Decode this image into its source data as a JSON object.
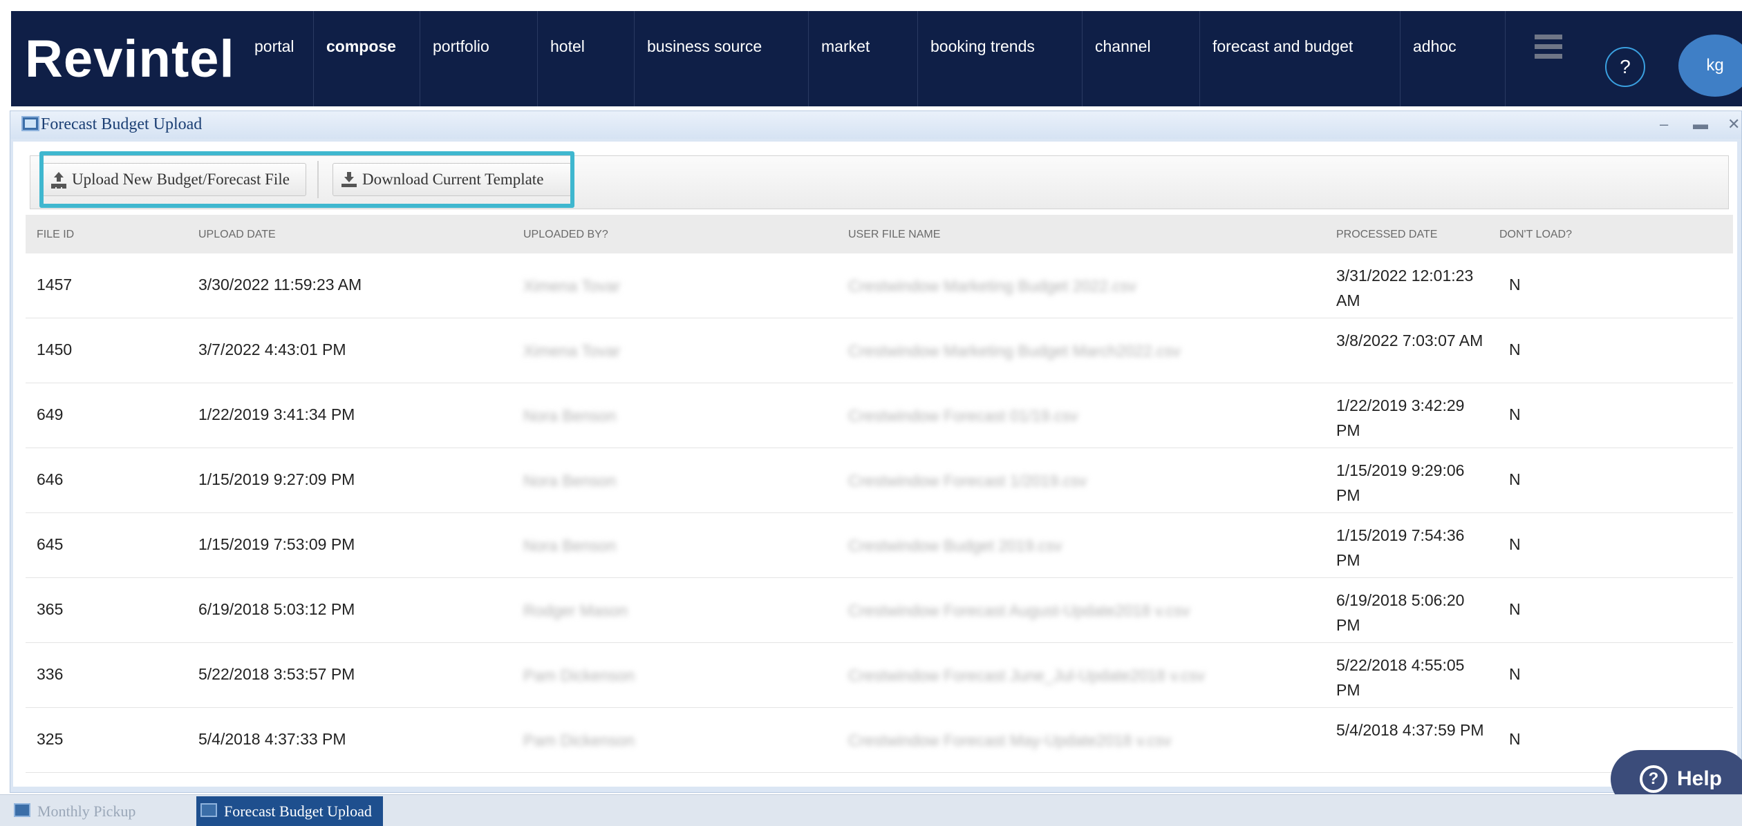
{
  "app": {
    "logo": "Revintel"
  },
  "nav": {
    "items": [
      {
        "label": "portal"
      },
      {
        "label": "compose"
      },
      {
        "label": "portfolio"
      },
      {
        "label": "hotel"
      },
      {
        "label": "business source"
      },
      {
        "label": "market"
      },
      {
        "label": "booking trends"
      },
      {
        "label": "channel"
      },
      {
        "label": "forecast and budget"
      },
      {
        "label": "adhoc"
      }
    ],
    "active": "compose",
    "help_glyph": "?",
    "avatar_initials": "kg"
  },
  "window": {
    "title": "Forecast Budget Upload",
    "controls": {
      "minimize": "–",
      "maximize": "▬",
      "close": "✕"
    }
  },
  "toolbar": {
    "upload_label": "Upload New Budget/Forecast File",
    "download_label": "Download Current Template"
  },
  "table": {
    "headers": {
      "file_id": "FILE ID",
      "upload_date": "UPLOAD DATE",
      "uploaded_by": "UPLOADED BY?",
      "user_file_name": "USER FILE NAME",
      "processed_date": "PROCESSED DATE",
      "dont_load": "DON'T LOAD?"
    },
    "rows": [
      {
        "file_id": "1457",
        "upload_date": "3/30/2022 11:59:23 AM",
        "uploaded_by": "Ximena Tovar",
        "user_file_name": "Crestwindow Marketing Budget 2022.csv",
        "processed_date": "3/31/2022 12:01:23 AM",
        "dont_load": "N"
      },
      {
        "file_id": "1450",
        "upload_date": "3/7/2022 4:43:01 PM",
        "uploaded_by": "Ximena Tovar",
        "user_file_name": "Crestwindow Marketing Budget March2022.csv",
        "processed_date": "3/8/2022 7:03:07 AM",
        "dont_load": "N"
      },
      {
        "file_id": "649",
        "upload_date": "1/22/2019 3:41:34 PM",
        "uploaded_by": "Nora Benson",
        "user_file_name": "Crestwindow Forecast 01/19.csv",
        "processed_date": "1/22/2019 3:42:29 PM",
        "dont_load": "N"
      },
      {
        "file_id": "646",
        "upload_date": "1/15/2019 9:27:09 PM",
        "uploaded_by": "Nora Benson",
        "user_file_name": "Crestwindow Forecast 1/2019.csv",
        "processed_date": "1/15/2019 9:29:06 PM",
        "dont_load": "N"
      },
      {
        "file_id": "645",
        "upload_date": "1/15/2019 7:53:09 PM",
        "uploaded_by": "Nora Benson",
        "user_file_name": "Crestwindow Budget 2019.csv",
        "processed_date": "1/15/2019 7:54:36 PM",
        "dont_load": "N"
      },
      {
        "file_id": "365",
        "upload_date": "6/19/2018 5:03:12 PM",
        "uploaded_by": "Rodger Mason",
        "user_file_name": "Crestwindow Forecast August-Update2018 v.csv",
        "processed_date": "6/19/2018 5:06:20 PM",
        "dont_load": "N"
      },
      {
        "file_id": "336",
        "upload_date": "5/22/2018 3:53:57 PM",
        "uploaded_by": "Pam Dickenson",
        "user_file_name": "Crestwindow Forecast June_Jul-Update2018 v.csv",
        "processed_date": "5/22/2018 4:55:05 PM",
        "dont_load": "N"
      },
      {
        "file_id": "325",
        "upload_date": "5/4/2018 4:37:33 PM",
        "uploaded_by": "Pam Dickenson",
        "user_file_name": "Crestwindow Forecast May-Update2018 v.csv",
        "processed_date": "5/4/2018 4:37:59 PM",
        "dont_load": "N"
      }
    ]
  },
  "help_button": {
    "label": "Help",
    "glyph": "?"
  },
  "taskbar": {
    "tasks": [
      {
        "label": "Monthly Pickup"
      },
      {
        "label": "Forecast Budget Upload"
      }
    ]
  },
  "colors": {
    "nav_bg": "#0f1f47",
    "highlight": "#3fb7cf",
    "avatar": "#3f7fc6",
    "active_task": "#1e4f8e"
  }
}
